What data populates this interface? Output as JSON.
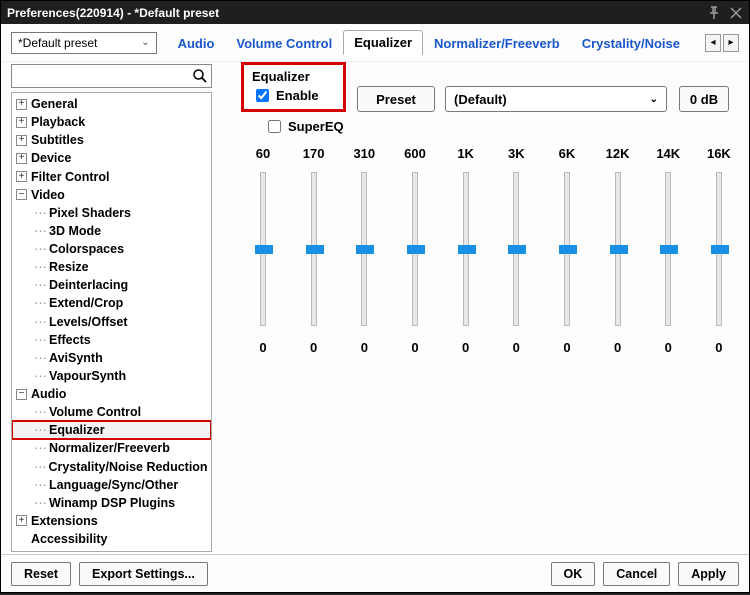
{
  "window": {
    "title": "Preferences(220914) - *Default preset"
  },
  "preset_combo": {
    "value": "*Default preset"
  },
  "tabs": {
    "items": [
      "Audio",
      "Volume Control",
      "Equalizer",
      "Normalizer/Freeverb",
      "Crystality/Noise"
    ],
    "active_index": 2
  },
  "tree": {
    "items": [
      {
        "label": "General",
        "exp": "+",
        "lvl": 0
      },
      {
        "label": "Playback",
        "exp": "+",
        "lvl": 0
      },
      {
        "label": "Subtitles",
        "exp": "+",
        "lvl": 0
      },
      {
        "label": "Device",
        "exp": "+",
        "lvl": 0
      },
      {
        "label": "Filter Control",
        "exp": "+",
        "lvl": 0
      },
      {
        "label": "Video",
        "exp": "-",
        "lvl": 0
      },
      {
        "label": "Pixel Shaders",
        "lvl": 1
      },
      {
        "label": "3D Mode",
        "lvl": 1
      },
      {
        "label": "Colorspaces",
        "lvl": 1
      },
      {
        "label": "Resize",
        "lvl": 1
      },
      {
        "label": "Deinterlacing",
        "lvl": 1
      },
      {
        "label": "Extend/Crop",
        "lvl": 1
      },
      {
        "label": "Levels/Offset",
        "lvl": 1
      },
      {
        "label": "Effects",
        "lvl": 1
      },
      {
        "label": "AviSynth",
        "lvl": 1
      },
      {
        "label": "VapourSynth",
        "lvl": 1
      },
      {
        "label": "Audio",
        "exp": "-",
        "lvl": 0
      },
      {
        "label": "Volume Control",
        "lvl": 1
      },
      {
        "label": "Equalizer",
        "lvl": 1,
        "sel": true,
        "hilite": true
      },
      {
        "label": "Normalizer/Freeverb",
        "lvl": 1
      },
      {
        "label": "Crystality/Noise Reduction",
        "lvl": 1
      },
      {
        "label": "Language/Sync/Other",
        "lvl": 1
      },
      {
        "label": "Winamp DSP Plugins",
        "lvl": 1
      },
      {
        "label": "Extensions",
        "exp": "+",
        "lvl": 0
      },
      {
        "label": "Accessibility",
        "lvl": 0
      }
    ]
  },
  "equalizer": {
    "group_title": "Equalizer",
    "enable_label": "Enable",
    "enable_checked": true,
    "supereq_label": "SuperEQ",
    "supereq_checked": false,
    "preset_btn": "Preset",
    "preset_value": "(Default)",
    "zerodb_btn": "0 dB",
    "bands": [
      {
        "freq": "60",
        "val": "0"
      },
      {
        "freq": "170",
        "val": "0"
      },
      {
        "freq": "310",
        "val": "0"
      },
      {
        "freq": "600",
        "val": "0"
      },
      {
        "freq": "1K",
        "val": "0"
      },
      {
        "freq": "3K",
        "val": "0"
      },
      {
        "freq": "6K",
        "val": "0"
      },
      {
        "freq": "12K",
        "val": "0"
      },
      {
        "freq": "14K",
        "val": "0"
      },
      {
        "freq": "16K",
        "val": "0"
      }
    ]
  },
  "footer": {
    "reset": "Reset",
    "export": "Export Settings...",
    "ok": "OK",
    "cancel": "Cancel",
    "apply": "Apply"
  },
  "search": {
    "placeholder": ""
  }
}
